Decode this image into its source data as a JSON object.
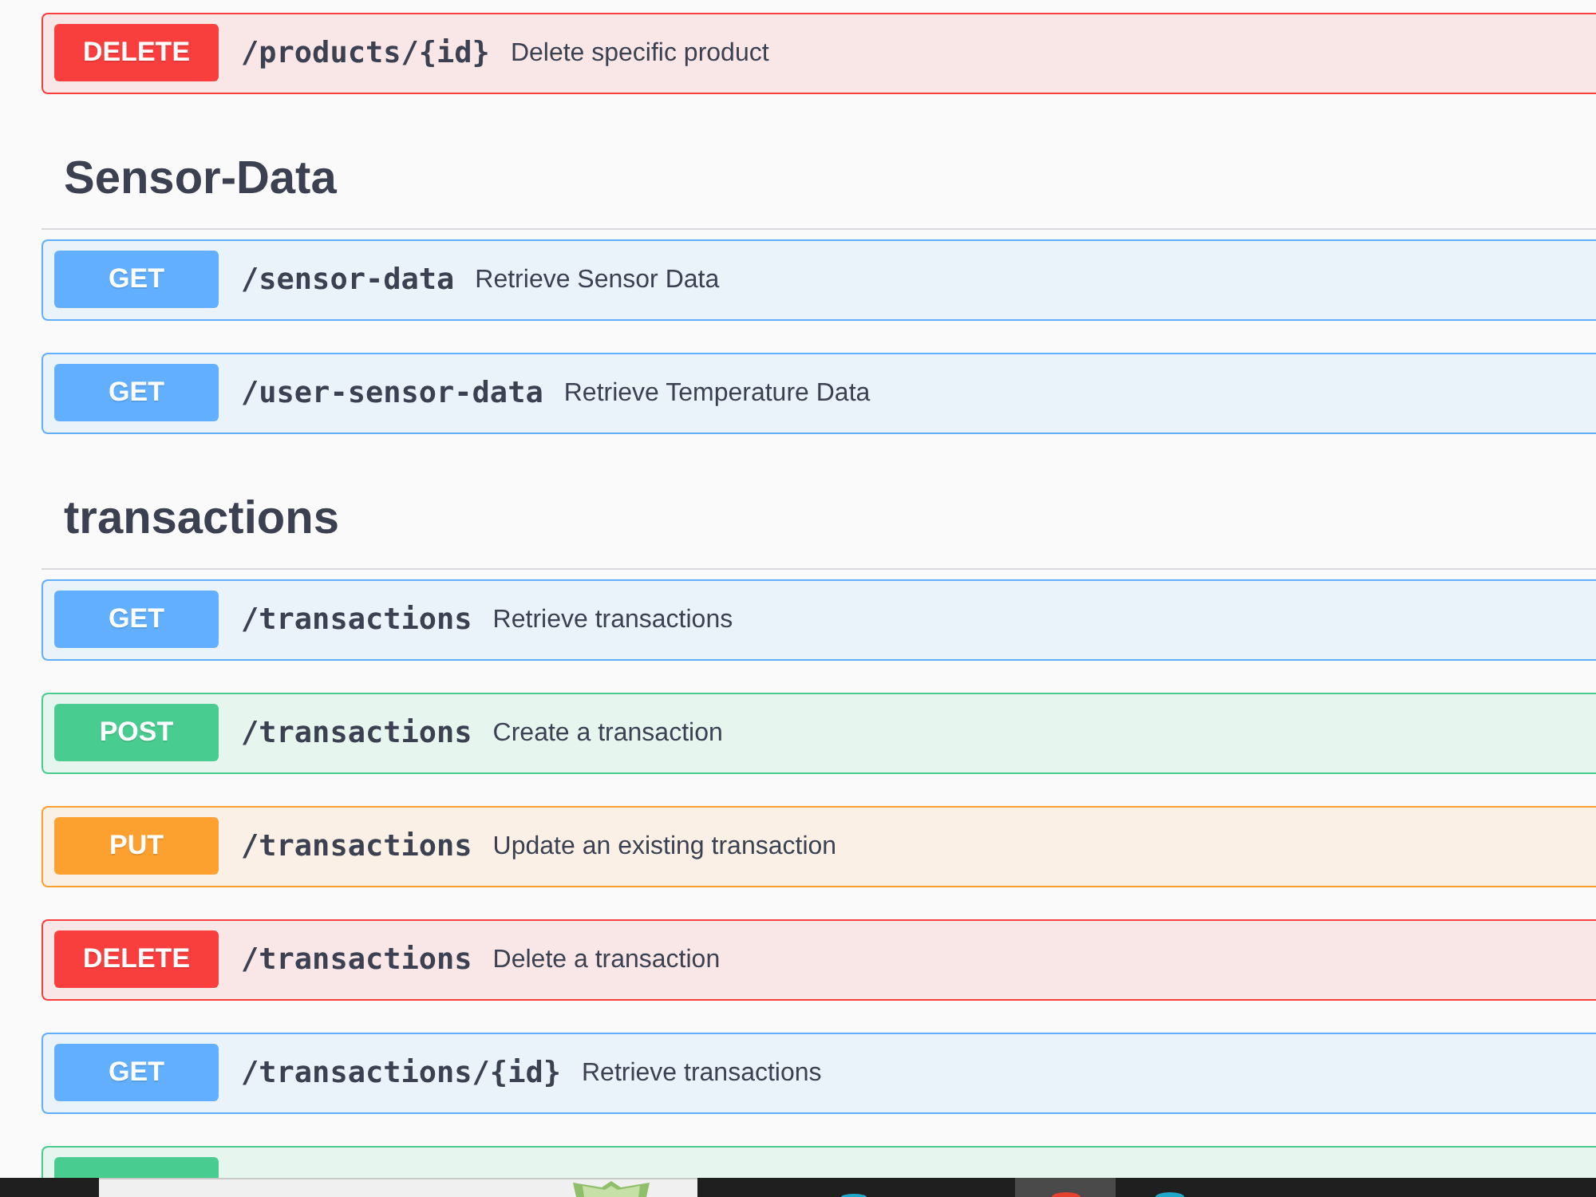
{
  "sections": [
    {
      "operations": [
        {
          "method": "DELETE",
          "color": "#f93e3e",
          "path": "/products/{id}",
          "summary": "Delete specific product"
        }
      ]
    },
    {
      "title": "Sensor-Data",
      "operations": [
        {
          "method": "GET",
          "color": "#61affe",
          "path": "/sensor-data",
          "summary": "Retrieve Sensor Data"
        },
        {
          "method": "GET",
          "color": "#61affe",
          "path": "/user-sensor-data",
          "summary": "Retrieve Temperature Data"
        }
      ]
    },
    {
      "title": "transactions",
      "operations": [
        {
          "method": "GET",
          "color": "#61affe",
          "path": "/transactions",
          "summary": "Retrieve transactions"
        },
        {
          "method": "POST",
          "color": "#49cc90",
          "path": "/transactions",
          "summary": "Create a transaction"
        },
        {
          "method": "PUT",
          "color": "#fca130",
          "path": "/transactions",
          "summary": "Update an existing transaction"
        },
        {
          "method": "DELETE",
          "color": "#f93e3e",
          "path": "/transactions",
          "summary": "Delete a transaction"
        },
        {
          "method": "GET",
          "color": "#61affe",
          "path": "/transactions/{id}",
          "summary": "Retrieve transactions"
        },
        {
          "color": "#49cc90"
        }
      ]
    }
  ],
  "taskbar": {
    "apps": [
      {
        "selected": true,
        "color": "#e5412d"
      },
      {
        "selected": false,
        "color": "#1fa8c9"
      }
    ]
  }
}
